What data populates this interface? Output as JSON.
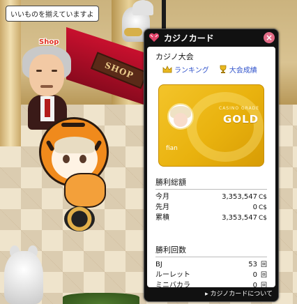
{
  "scene": {
    "speech_bubble": "いいものを揃えていますよ",
    "shop_name": "Shop",
    "shop_sign": "SHOP"
  },
  "panel": {
    "title": "カジノカード",
    "close_symbol": "×",
    "tournament_title": "カジノ大会",
    "links": {
      "ranking": "ランキング",
      "results": "大会成績"
    },
    "card": {
      "grade_label": "CASINO GRADE",
      "grade": "GOLD",
      "user_name": "fian"
    },
    "winnings": {
      "heading": "勝利総額",
      "rows": [
        {
          "label": "今月",
          "value": "3,353,547",
          "unit": "C$"
        },
        {
          "label": "先月",
          "value": "0",
          "unit": "C$"
        },
        {
          "label": "累積",
          "value": "3,353,547",
          "unit": "C$"
        }
      ]
    },
    "wins": {
      "heading": "勝利回数",
      "rows": [
        {
          "label": "BJ",
          "value": "53",
          "unit": "回"
        },
        {
          "label": "ルーレット",
          "value": "0",
          "unit": "回"
        },
        {
          "label": "ミニバカラ",
          "value": "0",
          "unit": "回"
        }
      ]
    },
    "footer_link": "▸ カジノカードについて"
  },
  "colors": {
    "panel_bg": "#111111",
    "card_gold": "#e9b20e",
    "link_blue": "#3355cc",
    "close_pink": "#e26b86"
  },
  "icons": [
    "heart-icon",
    "close-icon",
    "crown-icon",
    "trophy-icon"
  ]
}
